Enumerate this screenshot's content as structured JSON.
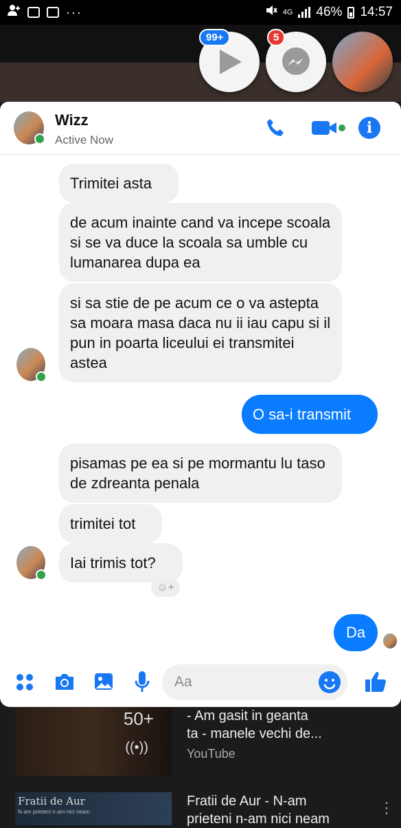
{
  "status_bar": {
    "more": "···",
    "network": "4G",
    "battery": "46%",
    "time": "14:57"
  },
  "chat_heads": {
    "video_badge": "99+",
    "messenger_badge": "5"
  },
  "header": {
    "name": "Wizz",
    "status": "Active Now"
  },
  "messages": [
    {
      "text": "Trimitei asta"
    },
    {
      "text": "de acum inainte cand va incepe scoala si se va duce la scoala sa umble cu lumanarea dupa ea"
    },
    {
      "text": "si sa stie de pe acum ce o va astepta sa moara masa daca nu ii iau capu si il pun in poarta liceului ei transmitei astea"
    },
    {
      "text": "O sa-i transmit"
    },
    {
      "text": "pisamas pe ea si pe mormantu lu taso de zdreanta penala"
    },
    {
      "text": "trimitei tot"
    },
    {
      "text": "Iai trimis tot?"
    },
    {
      "text": "Da"
    }
  ],
  "composer": {
    "placeholder": "Aa"
  },
  "youtube": {
    "item1_count": "50+",
    "item1_title_line1": "- Am gasit in geanta",
    "item1_title_line2": "ta - manele vechi  de...",
    "item1_source": "YouTube",
    "item2_thumb_title": "Fratii de Aur",
    "item2_thumb_subtitle": "N-am prieteni n-am nici neam",
    "item2_title_line1": "Fratii de Aur - N-am",
    "item2_title_line2": "prieteni n-am nici neam"
  },
  "colors": {
    "accent": "#1877f2",
    "outgoing_bubble": "#0a7cff",
    "incoming_bubble": "#f1f0f0",
    "online": "#31a24c",
    "badge_red": "#e53935"
  }
}
